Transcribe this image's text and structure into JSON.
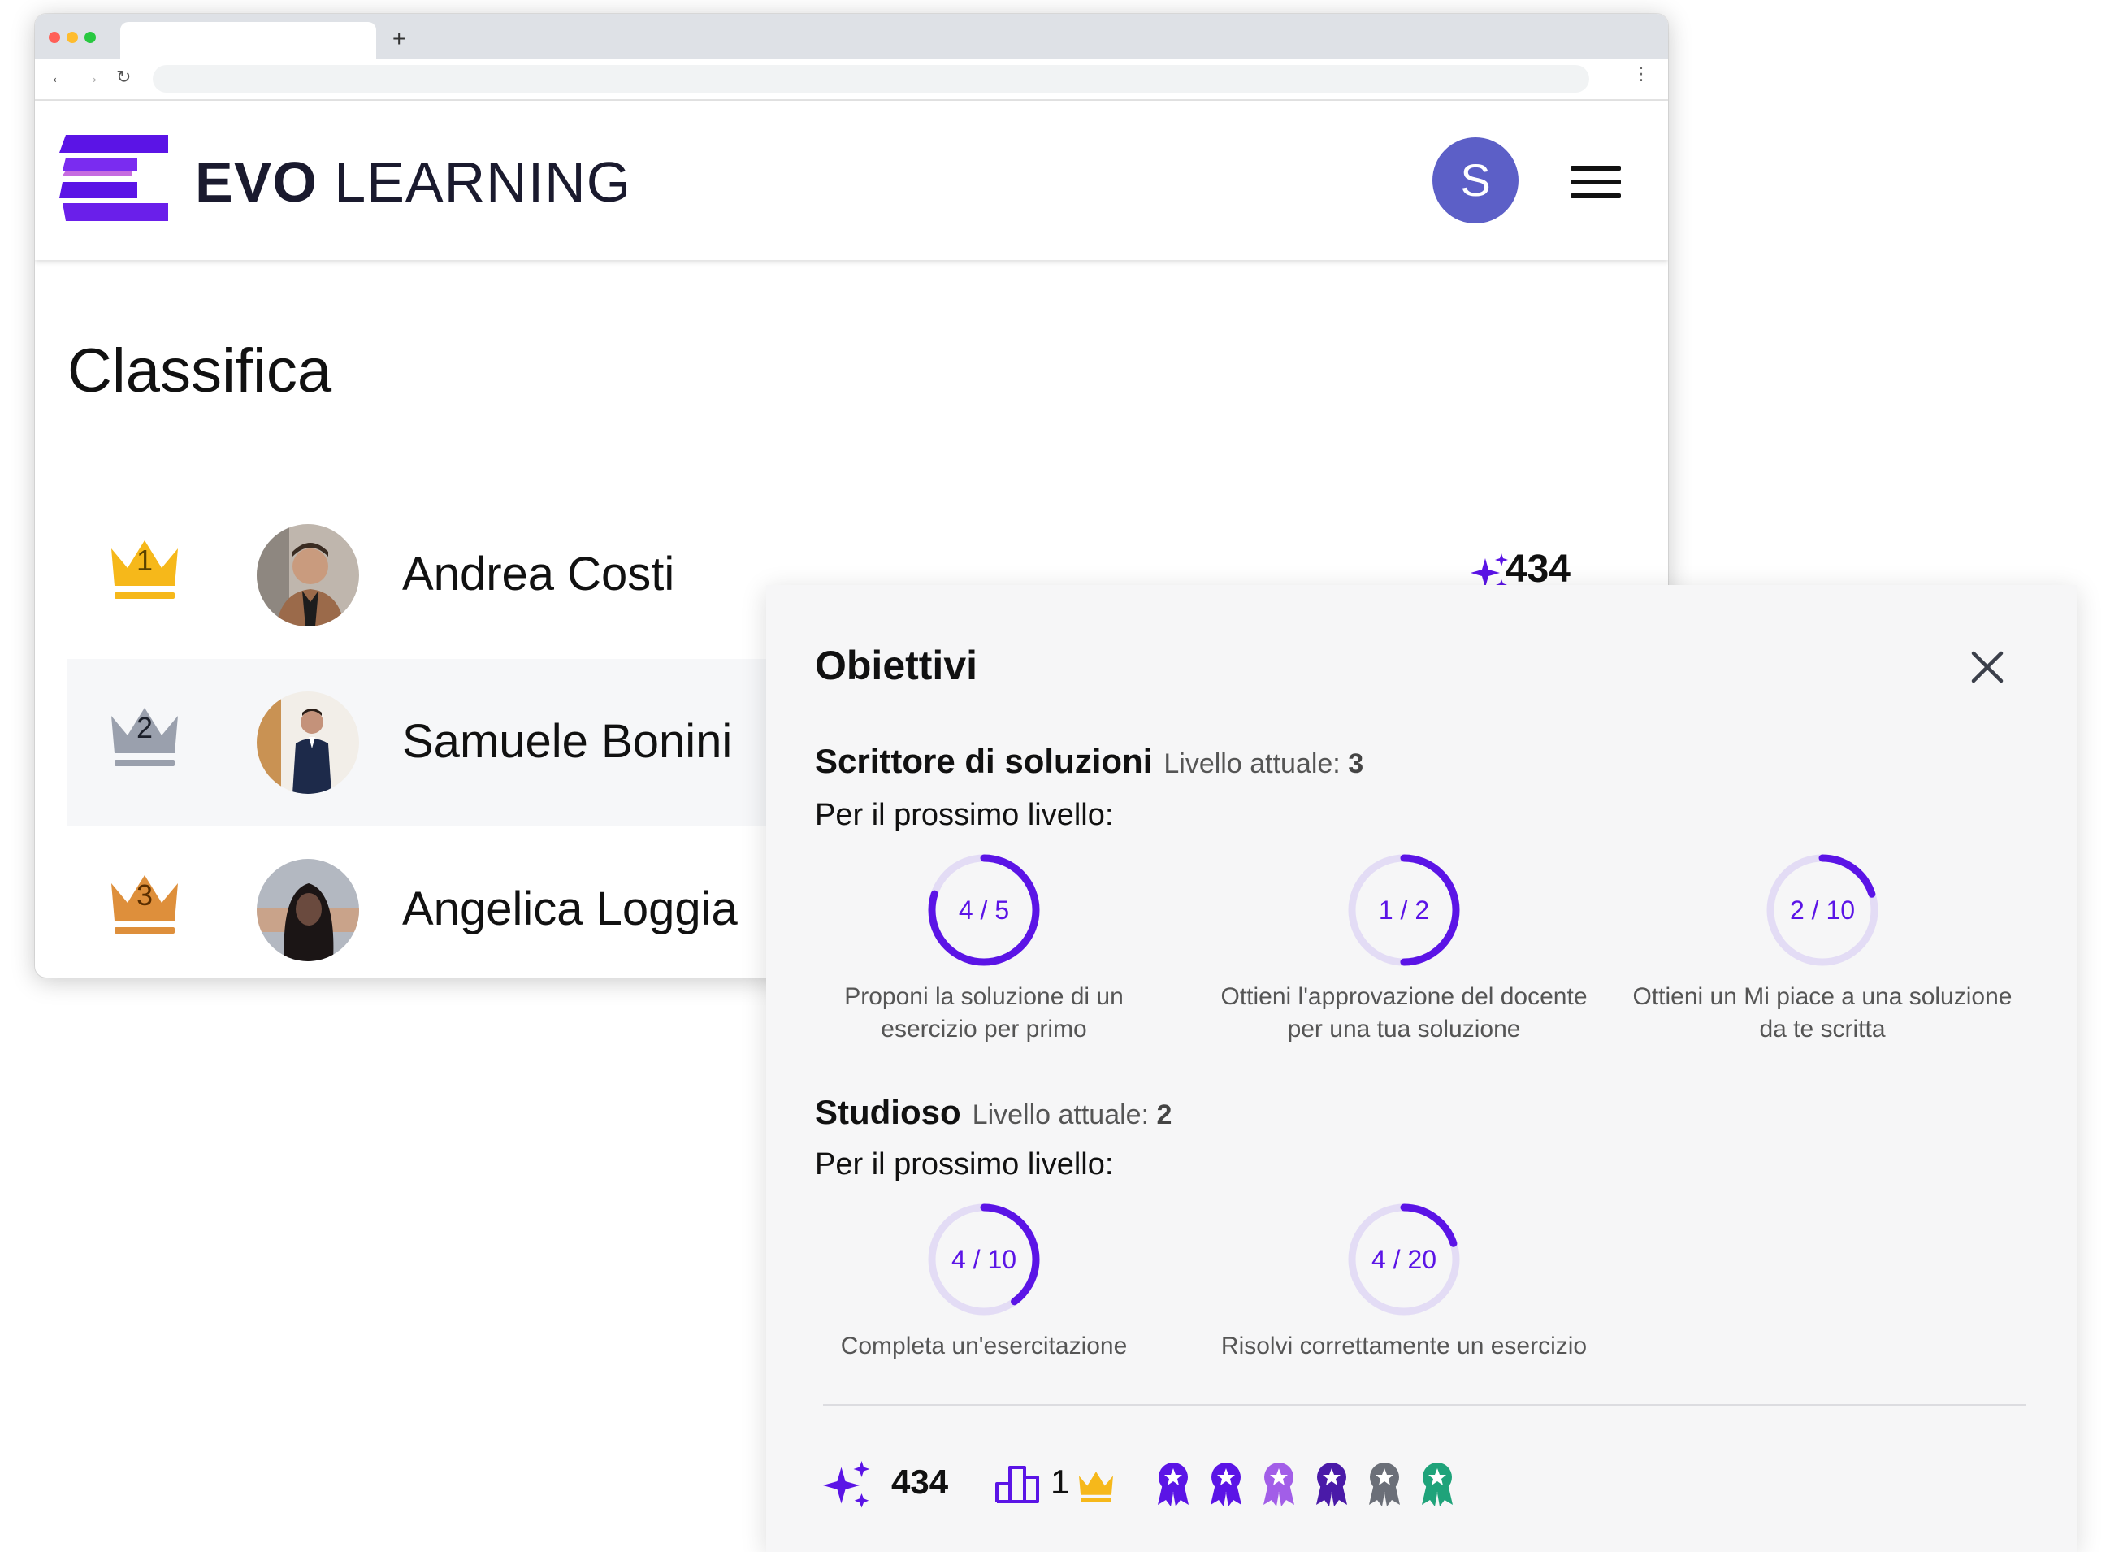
{
  "browser": {
    "new_tab_label": "+",
    "back_icon": "←",
    "forward_icon": "→",
    "reload_icon": "↻",
    "menu_icon": "⋮"
  },
  "header": {
    "brand_bold": "EVO",
    "brand_light": "LEARNING",
    "user_initial": "S"
  },
  "leaderboard": {
    "title": "Classifica",
    "rows": [
      {
        "rank": "1",
        "name": "Andrea Costi",
        "score": "434",
        "crown_color": "#f6b81a"
      },
      {
        "rank": "2",
        "name": "Samuele Bonini",
        "crown_color": "#9aa0ad"
      },
      {
        "rank": "3",
        "name": "Angelica Loggia",
        "crown_color": "#de8f3b"
      }
    ]
  },
  "objectives": {
    "title": "Obiettivi",
    "sections": [
      {
        "name": "Scrittore di soluzioni",
        "level_label": "Livello attuale:",
        "level_value": "3",
        "next_label": "Per il prossimo livello:",
        "goals": [
          {
            "progress_text": "4 / 5",
            "current": 4,
            "target": 5,
            "label_line1": "Proponi la soluzione di un",
            "label_line2": "esercizio per primo"
          },
          {
            "progress_text": "1 / 2",
            "current": 1,
            "target": 2,
            "label_line1": "Ottieni l'approvazione del docente",
            "label_line2": "per una tua soluzione"
          },
          {
            "progress_text": "2 / 10",
            "current": 2,
            "target": 10,
            "label_line1": "Ottieni un Mi piace a una soluzione",
            "label_line2": "da te scritta"
          }
        ]
      },
      {
        "name": "Studioso",
        "level_label": "Livello attuale:",
        "level_value": "2",
        "next_label": "Per il prossimo livello:",
        "goals": [
          {
            "progress_text": "4 / 10",
            "current": 4,
            "target": 10,
            "label_line1": "Completa un'esercitazione",
            "label_line2": ""
          },
          {
            "progress_text": "4 / 20",
            "current": 4,
            "target": 20,
            "label_line1": "Risolvi correttamente un esercizio",
            "label_line2": ""
          }
        ]
      }
    ],
    "footer": {
      "points": "434",
      "rank": "1",
      "badge_colors": [
        "#5b14e6",
        "#5b14e6",
        "#a25ee8",
        "#4a1aa8",
        "#6b6f78",
        "#1fa37a"
      ]
    }
  },
  "colors": {
    "accent": "#5b14e6",
    "ring_track": "#e3dcf5",
    "avatar": "#5c5fc7"
  },
  "icons": {
    "sparkle": "sparkle-icon",
    "podium": "podium-icon",
    "crown": "crown-icon",
    "badge": "ribbon-badge-icon",
    "close": "close-icon",
    "menu": "hamburger-icon"
  }
}
